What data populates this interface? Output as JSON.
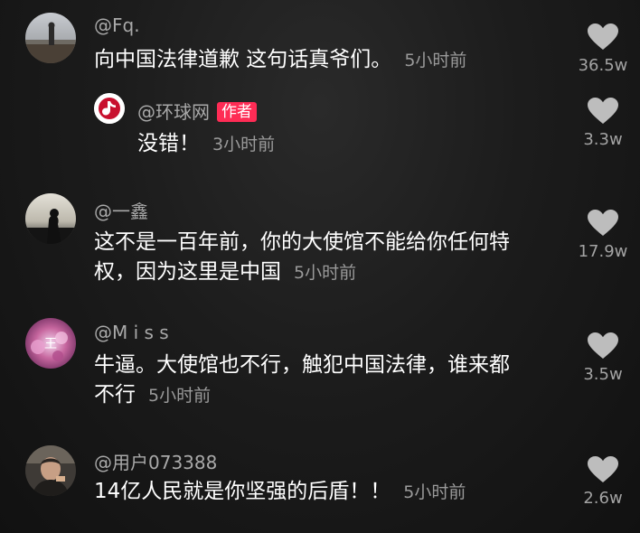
{
  "comments": [
    {
      "username": "@Fq.",
      "text": "向中国法律道歉 这句话真爷们。",
      "time": "5小时前",
      "likes": "36.5w",
      "icon": "heart-icon"
    },
    {
      "username": "@环球网",
      "badge": "作者",
      "text": "没错！",
      "time": "3小时前",
      "likes": "3.3w",
      "icon": "heart-icon"
    },
    {
      "username": "@一鑫",
      "text_line1": "这不是一百年前，你的大使馆不能给你任何特",
      "text_line2": "权，因为这里是中国",
      "time": "5小时前",
      "likes": "17.9w",
      "icon": "heart-icon"
    },
    {
      "username": "@M i s s",
      "text_line1": "牛逼。大使馆也不行，触犯中国法律，谁来都",
      "text_line2": "不行",
      "time": "5小时前",
      "likes": "3.5w",
      "icon": "heart-icon"
    },
    {
      "username": "@用户073388",
      "text": "14亿人民就是你坚强的后盾！！",
      "time": "5小时前",
      "likes": "2.6w",
      "icon": "heart-icon"
    }
  ],
  "colors": {
    "background": "#141414",
    "username": "#a9a9a9",
    "text": "#ffffff",
    "time": "#9a9a9a",
    "heart": "#bdbdbd",
    "author_badge": "#fe2c55"
  }
}
